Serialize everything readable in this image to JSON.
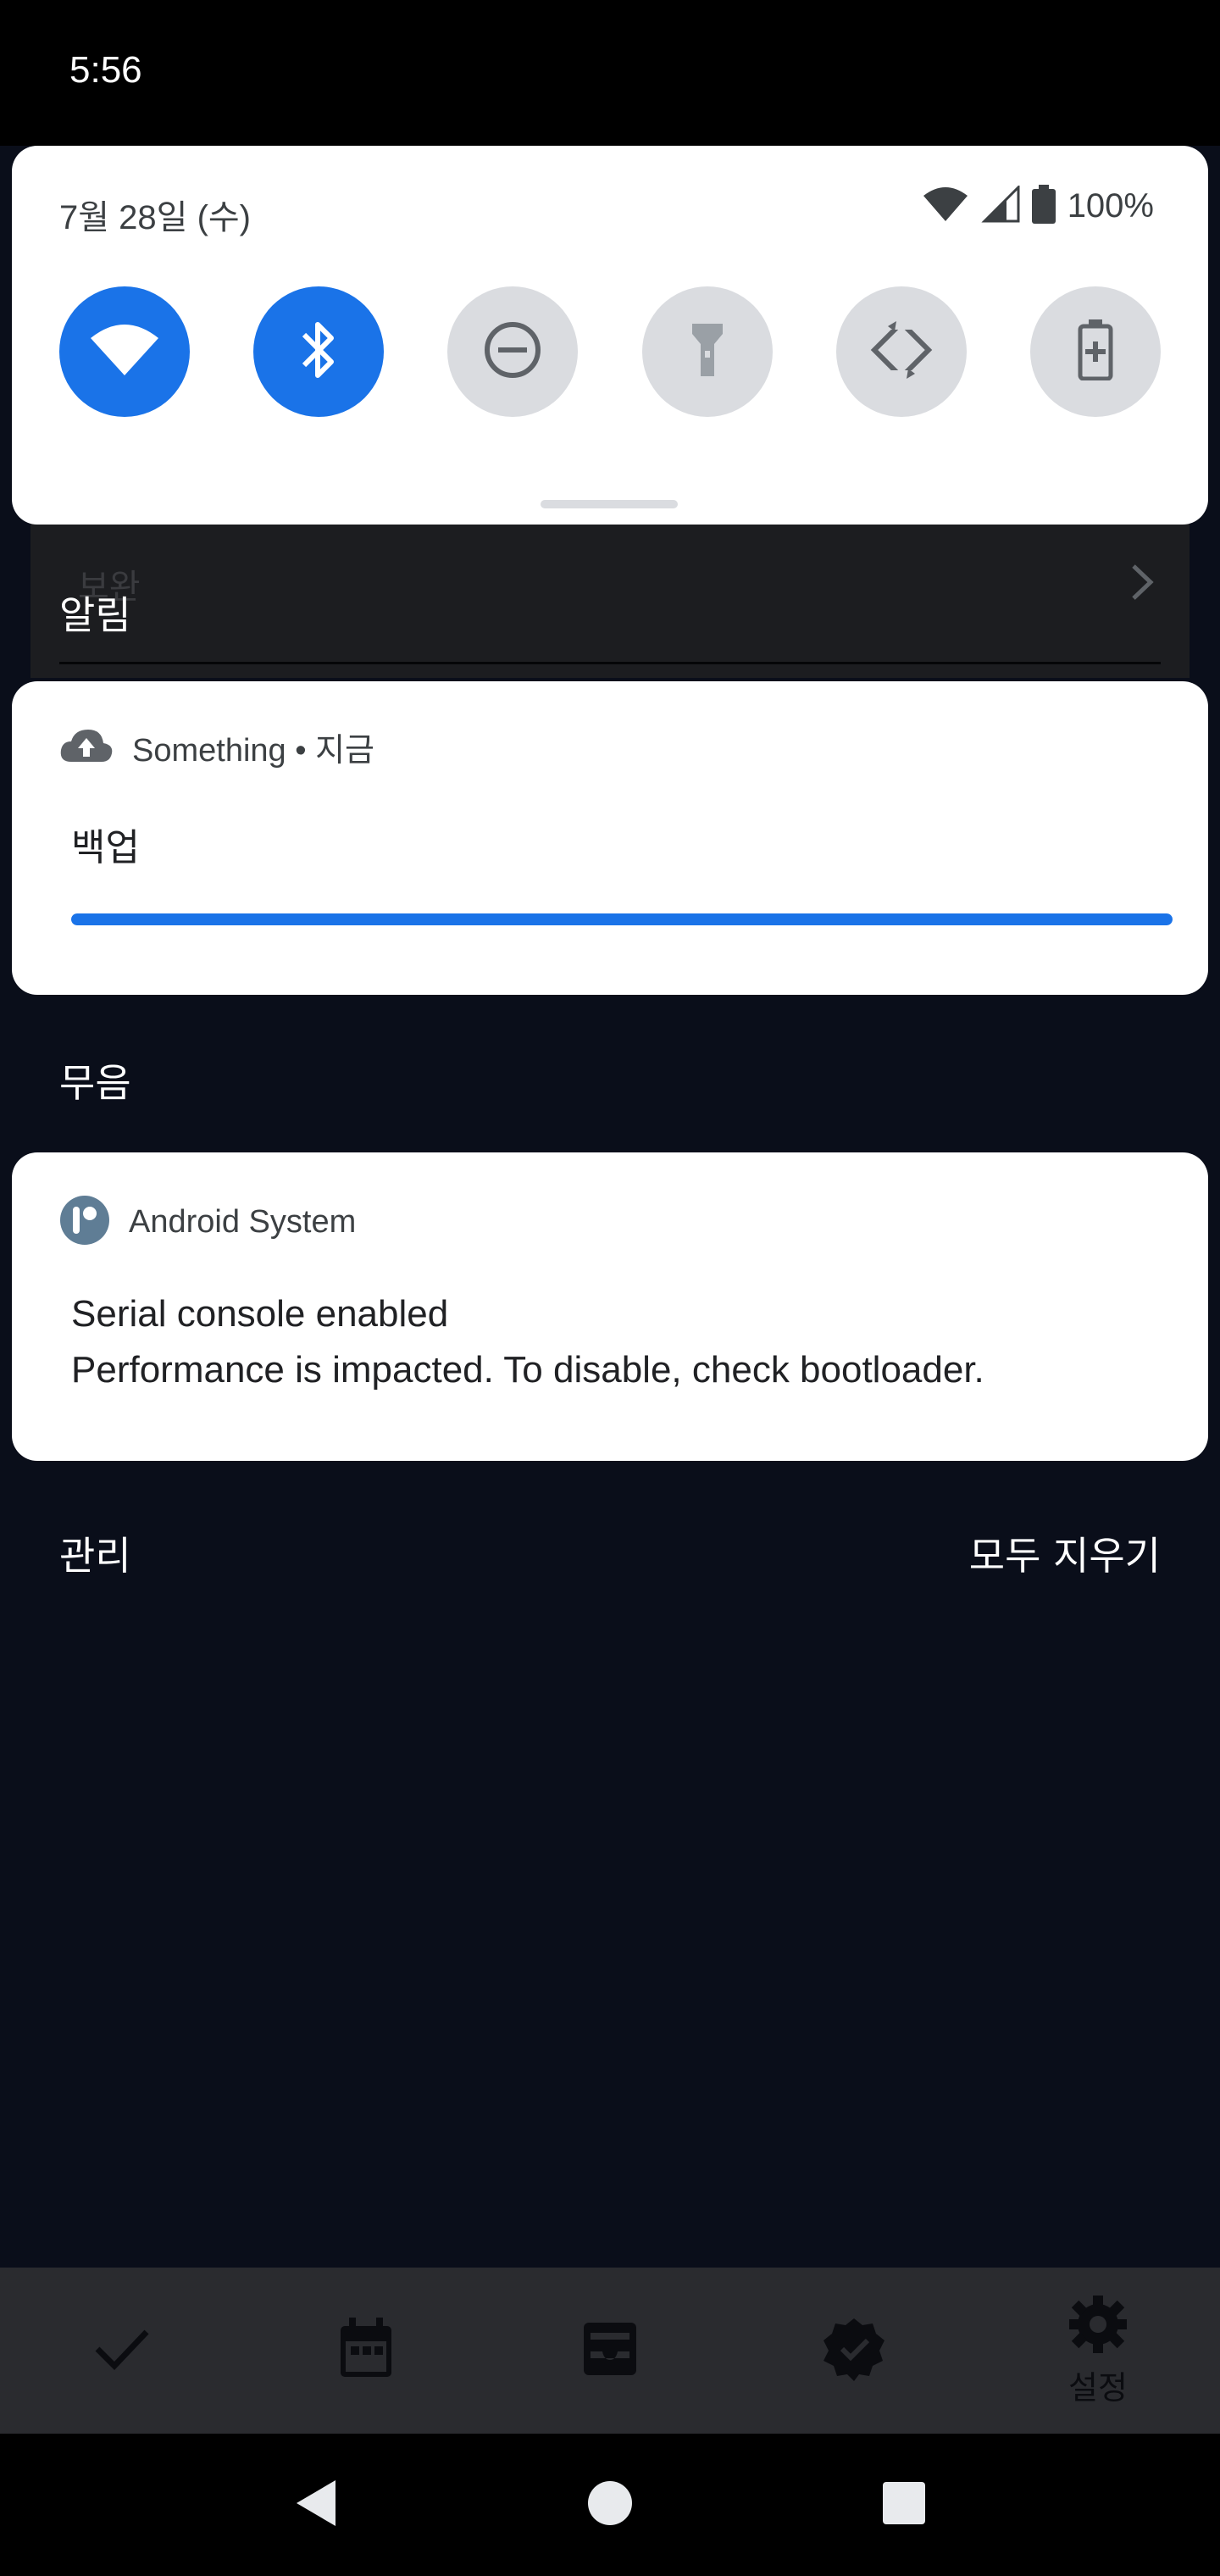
{
  "status_bar": {
    "time": "5:56"
  },
  "quick_settings": {
    "date": "7월 28일 (수)",
    "battery_percent": "100%",
    "tiles": [
      {
        "name": "wifi",
        "icon": "wifi-icon",
        "active": true
      },
      {
        "name": "bluetooth",
        "icon": "bluetooth-icon",
        "active": true
      },
      {
        "name": "do-not-disturb",
        "icon": "dnd-icon",
        "active": false
      },
      {
        "name": "flashlight",
        "icon": "flashlight-icon",
        "active": false
      },
      {
        "name": "auto-rotate",
        "icon": "rotate-icon",
        "active": false
      },
      {
        "name": "battery-saver",
        "icon": "battery-saver-icon",
        "active": false
      }
    ]
  },
  "background_app": {
    "item_text": "보완"
  },
  "alerts_section": {
    "title": "알림",
    "notification": {
      "app_label": "Something • 지금",
      "title": "백업",
      "progress": 1.0
    }
  },
  "silent_section": {
    "title": "무음",
    "notification": {
      "app_label": "Android System",
      "title": "Serial console enabled",
      "body": "Performance is impacted. To disable, check bootloader."
    }
  },
  "footer": {
    "manage_label": "관리",
    "clear_all_label": "모두 지우기"
  },
  "app_nav": {
    "items": [
      {
        "icon": "check-icon"
      },
      {
        "icon": "calendar-icon"
      },
      {
        "icon": "inbox-icon"
      },
      {
        "icon": "verified-icon"
      },
      {
        "icon": "settings-icon",
        "label": "설정"
      }
    ]
  },
  "colors": {
    "accent": "#1a73e8",
    "scrim": "#0a0e1a",
    "card_bg": "#ffffff",
    "tile_off": "#dadce0"
  }
}
